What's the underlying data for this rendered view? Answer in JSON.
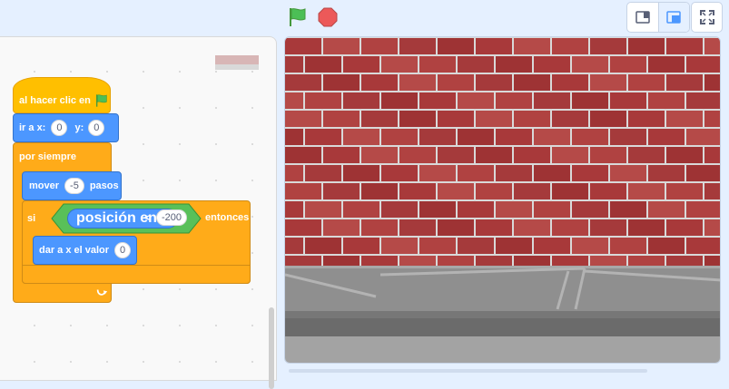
{
  "blocks": {
    "hat": {
      "text": "al hacer clic en"
    },
    "goto": {
      "text": "ir a x:",
      "x_value": "0",
      "y_label": "y:",
      "y_value": "0"
    },
    "forever": {
      "text": "por siempre"
    },
    "move": {
      "text": "mover",
      "value": "-5",
      "suffix": "pasos"
    },
    "if_block": {
      "text": "si",
      "reporter": "posición en x",
      "operator": "<",
      "value": "-200",
      "suffix": "entonces"
    },
    "set_x": {
      "text": "dar a x el valor",
      "value": "0"
    }
  },
  "icons": {
    "green_flag": "green-flag-icon",
    "stop": "stop-icon",
    "small_stage": "small-stage-icon",
    "normal_stage": "normal-stage-icon",
    "fullscreen": "fullscreen-icon",
    "loop_arrow": "loop-arrow-icon"
  },
  "colors": {
    "events": "#ffbf00",
    "motion": "#4c97ff",
    "control": "#ffab19",
    "operators": "#59c059",
    "brick": "#a8393a",
    "mortar": "#d9d9d9",
    "ground": "#8f8f8f"
  }
}
